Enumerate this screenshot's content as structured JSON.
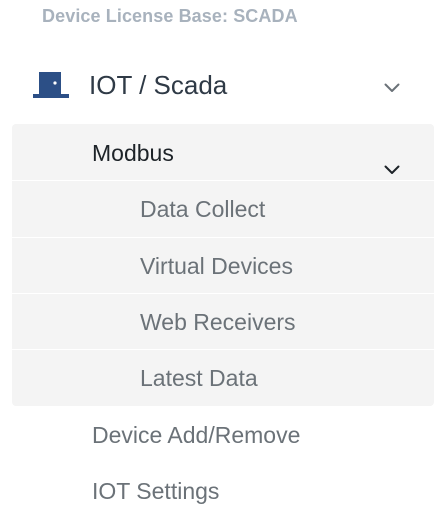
{
  "license": {
    "text": "Device License Base: SCADA"
  },
  "section": {
    "icon": "door-icon",
    "label": "IOT / Scada",
    "expanded": true,
    "icon_color": "#2c4f86"
  },
  "subsection": {
    "label": "Modbus",
    "expanded": true,
    "items": [
      {
        "label": "Data Collect"
      },
      {
        "label": "Virtual Devices"
      },
      {
        "label": "Web Receivers"
      },
      {
        "label": "Latest Data"
      }
    ]
  },
  "items": [
    {
      "label": "Device Add/Remove"
    },
    {
      "label": "IOT Settings"
    }
  ]
}
